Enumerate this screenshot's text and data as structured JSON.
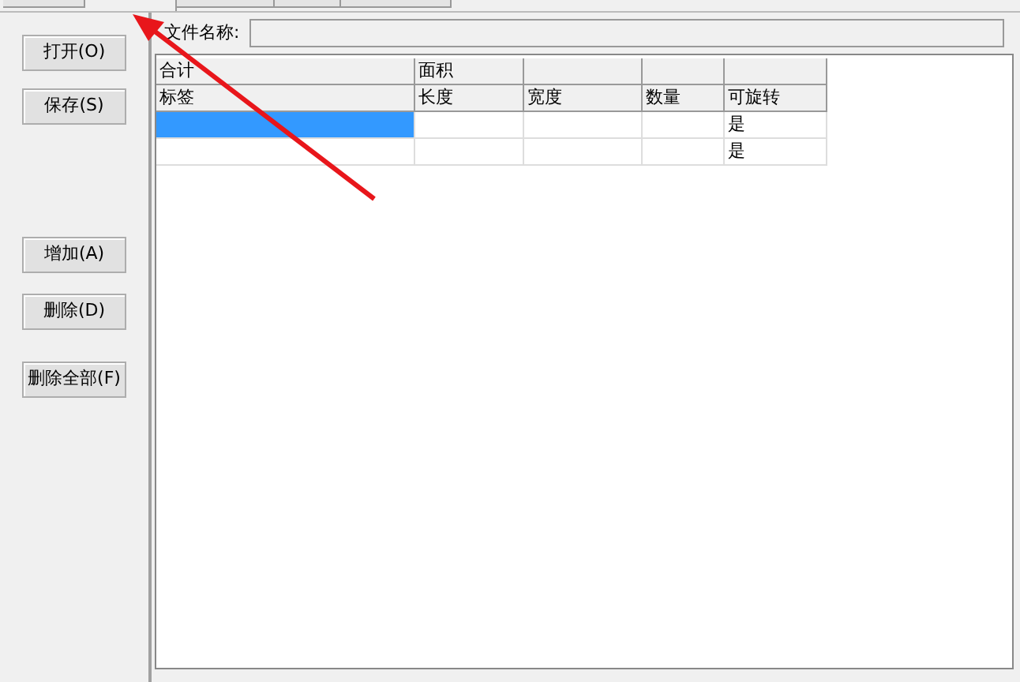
{
  "tabs": [
    {
      "selected": false
    },
    {
      "selected": true
    },
    {
      "selected": false
    },
    {
      "selected": false
    },
    {
      "selected": false
    }
  ],
  "buttons": [
    {
      "label": "打开(O)"
    },
    {
      "label": "保存(S)"
    },
    {
      "label": "增加(A)"
    },
    {
      "label": "删除(D)"
    },
    {
      "label": "删除全部(F)"
    }
  ],
  "file_name": {
    "label": "文件名称:"
  },
  "table": {
    "summary_row": [
      "合计",
      "面积"
    ],
    "columns": [
      "标签",
      "长度",
      "宽度",
      "数量",
      "可旋转"
    ],
    "rows": [
      {
        "selected": true,
        "rotatable": "是"
      },
      {
        "selected": false,
        "rotatable": "是"
      }
    ]
  }
}
